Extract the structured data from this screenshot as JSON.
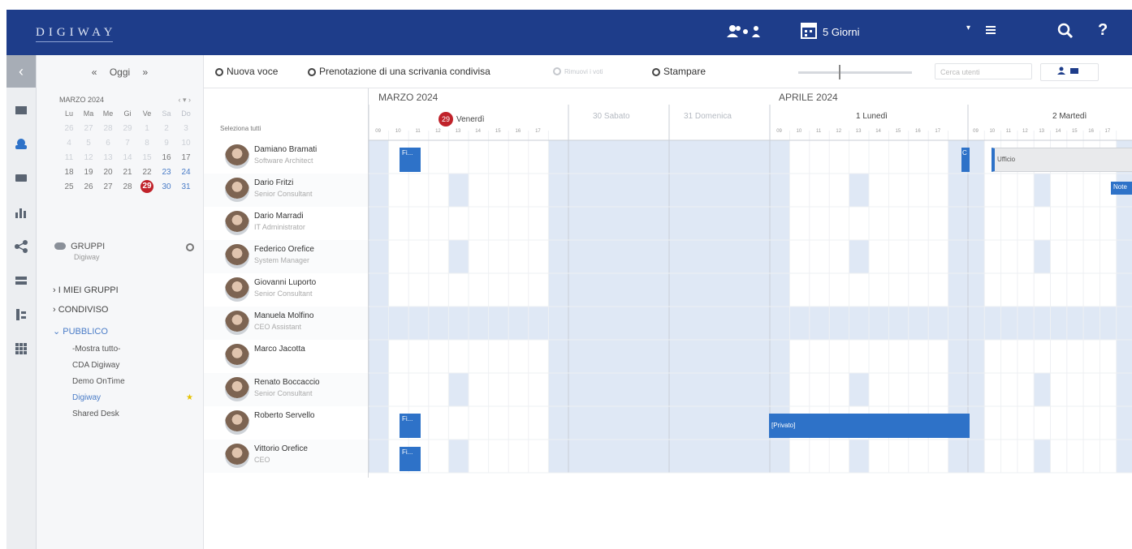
{
  "app": {
    "logo": "DIGIWAY"
  },
  "topbar": {
    "view_label": "5 Giorni",
    "help_label": "?"
  },
  "leftnav": {
    "prev": "«",
    "today": "Oggi",
    "next": "»"
  },
  "minical": {
    "title": "MARZO 2024",
    "weekdays": [
      "Lu",
      "Ma",
      "Me",
      "Gi",
      "Ve",
      "Sa",
      "Do"
    ],
    "rows": [
      [
        "26",
        "27",
        "28",
        "29",
        "1",
        "2",
        "3"
      ],
      [
        "4",
        "5",
        "6",
        "7",
        "8",
        "9",
        "10"
      ],
      [
        "11",
        "12",
        "13",
        "14",
        "15",
        "16",
        "17"
      ],
      [
        "18",
        "19",
        "20",
        "21",
        "22",
        "23",
        "24"
      ],
      [
        "25",
        "26",
        "27",
        "28",
        "29",
        "30",
        "31"
      ]
    ],
    "today": "29"
  },
  "groups": {
    "title": "GRUPPI",
    "subtitle": "Digiway",
    "items": [
      "I MIEI GRUPPI",
      "CONDIVISO",
      "PUBBLICO"
    ],
    "sub_items": [
      "-Mostra tutto-",
      "CDA Digiway",
      "Demo OnTime",
      "Digiway",
      "Shared Desk"
    ]
  },
  "toolbar": {
    "new_item": "Nuova voce",
    "book_desk": "Prenotazione di una scrivania condivisa",
    "disabled_action": "Rimuovi i voti",
    "print": "Stampare",
    "search_placeholder": "Cerca utenti"
  },
  "scheduler": {
    "select_all": "Seleziona tutti",
    "months": [
      "MARZO 2024",
      "APRILE 2024"
    ],
    "days": [
      {
        "label": "Venerdì",
        "badge": "29",
        "weekend": false
      },
      {
        "label": "30 Sabato",
        "weekend": true
      },
      {
        "label": "31 Domenica",
        "weekend": true
      },
      {
        "label": "1 Lunedì",
        "weekend": false
      },
      {
        "label": "2 Martedì",
        "weekend": false
      }
    ],
    "hours": [
      "09",
      "10",
      "11",
      "12",
      "13",
      "14",
      "15",
      "16",
      "17"
    ],
    "people": [
      {
        "name": "Damiano Bramati",
        "role": "Software Architect"
      },
      {
        "name": "Dario Fritzi",
        "role": "Senior Consultant"
      },
      {
        "name": "Dario Marradi",
        "role": "IT Administrator"
      },
      {
        "name": "Federico Orefice",
        "role": "System Manager"
      },
      {
        "name": "Giovanni Luporto",
        "role": "Senior Consultant"
      },
      {
        "name": "Manuela Molfino",
        "role": "CEO Assistant"
      },
      {
        "name": "Marco Jacotta",
        "role": ""
      },
      {
        "name": "Renato Boccaccio",
        "role": "Senior Consultant"
      },
      {
        "name": "Roberto Servello",
        "role": ""
      },
      {
        "name": "Vittorio Orefice",
        "role": "CEO"
      }
    ],
    "events": [
      {
        "label": "Fi..."
      },
      {
        "label": "C"
      },
      {
        "label": "Ufficio"
      },
      {
        "label": "Note"
      },
      {
        "label": "Fi..."
      },
      {
        "label": "[Privato]"
      },
      {
        "label": "Fi..."
      }
    ]
  },
  "colors": {
    "topbar": "#1e3d8a",
    "event": "#2e72c8",
    "today": "#c0222a",
    "shade": "#dfe8f5"
  }
}
